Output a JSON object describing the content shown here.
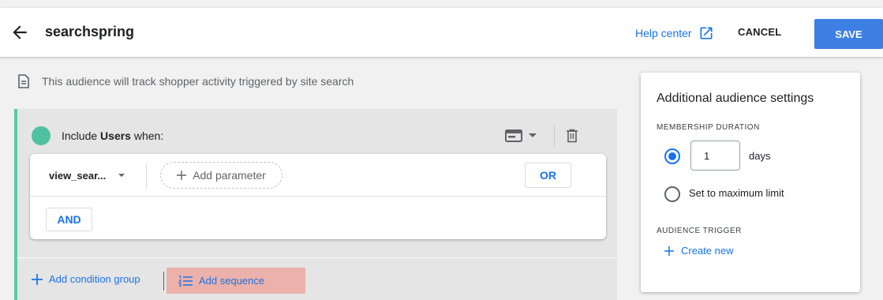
{
  "header": {
    "title": "searchspring",
    "help_label": "Help center",
    "cancel_label": "CANCEL",
    "save_label": "SAVE"
  },
  "info_text": "This audience will track shopper activity triggered by site search",
  "condition_group": {
    "include_prefix": "Include",
    "include_target": "Users",
    "include_suffix": "when:",
    "event_name": "view_sear...",
    "add_parameter_label": "Add parameter",
    "or_label": "OR",
    "and_label": "AND"
  },
  "footer": {
    "add_condition_group_label": "Add condition group",
    "add_sequence_label": "Add sequence"
  },
  "settings_panel": {
    "title": "Additional audience settings",
    "membership_label": "MEMBERSHIP DURATION",
    "duration_value": "1",
    "duration_unit": "days",
    "max_limit_label": "Set to maximum limit",
    "trigger_label": "AUDIENCE TRIGGER",
    "create_new_label": "Create new"
  },
  "colors": {
    "accent": "#1a73e8",
    "save_button": "#3d7fe2",
    "group_dot": "#4fc1a0",
    "group_border": "#5cc7a9",
    "sequence_highlight": "#ebb1aa"
  }
}
